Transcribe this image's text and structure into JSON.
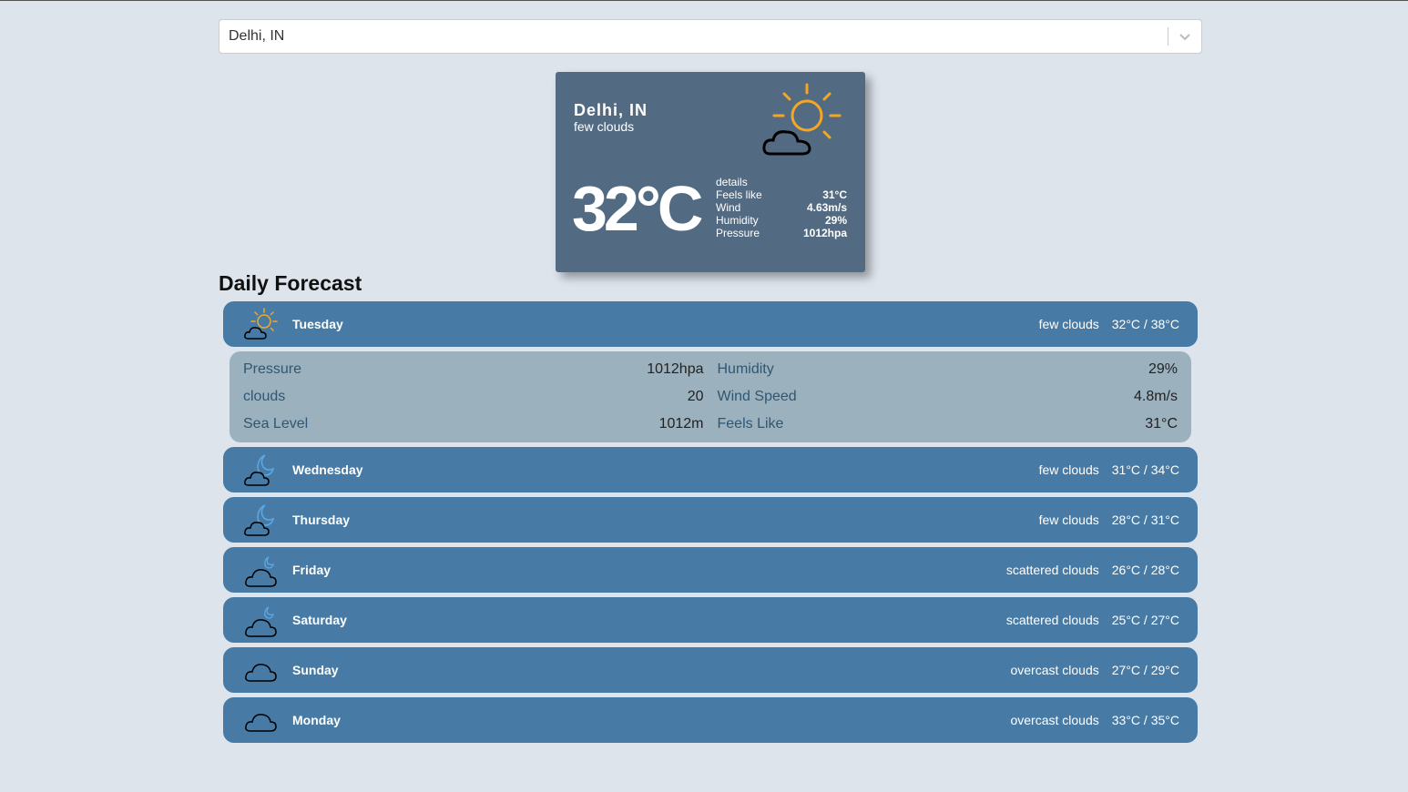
{
  "search": {
    "value": "Delhi, IN"
  },
  "current": {
    "city": "Delhi, IN",
    "description": "few clouds",
    "temp": "32°C",
    "details_heading": "details",
    "details": [
      {
        "label": "Feels like",
        "value": "31°C"
      },
      {
        "label": "Wind",
        "value": "4.63m/s"
      },
      {
        "label": "Humidity",
        "value": "29%"
      },
      {
        "label": "Pressure",
        "value": "1012hpa"
      }
    ],
    "icon": "partly-cloudy-day-icon"
  },
  "forecast": {
    "title": "Daily Forecast",
    "days": [
      {
        "name": "Tuesday",
        "desc": "few clouds",
        "temp": "32°C / 38°C",
        "icon": "partly-cloudy-day-icon",
        "expanded": true
      },
      {
        "name": "Wednesday",
        "desc": "few clouds",
        "temp": "31°C / 34°C",
        "icon": "partly-cloudy-night-icon"
      },
      {
        "name": "Thursday",
        "desc": "few clouds",
        "temp": "28°C / 31°C",
        "icon": "partly-cloudy-night-icon"
      },
      {
        "name": "Friday",
        "desc": "scattered clouds",
        "temp": "26°C / 28°C",
        "icon": "cloudy-night-icon"
      },
      {
        "name": "Saturday",
        "desc": "scattered clouds",
        "temp": "25°C / 27°C",
        "icon": "cloudy-night-icon"
      },
      {
        "name": "Sunday",
        "desc": "overcast clouds",
        "temp": "27°C / 29°C",
        "icon": "cloud-icon"
      },
      {
        "name": "Monday",
        "desc": "overcast clouds",
        "temp": "33°C / 35°C",
        "icon": "cloud-icon"
      }
    ],
    "expanded_details": {
      "left": [
        {
          "label": "Pressure",
          "value": "1012hpa"
        },
        {
          "label": "clouds",
          "value": "20"
        },
        {
          "label": "Sea Level",
          "value": "1012m"
        }
      ],
      "right": [
        {
          "label": "Humidity",
          "value": "29%"
        },
        {
          "label": "Wind Speed",
          "value": "4.8m/s"
        },
        {
          "label": "Feels Like",
          "value": "31°C"
        }
      ]
    }
  },
  "colors": {
    "background": "#dde4ec",
    "card": "#536b82",
    "day_bar": "#477ba5",
    "details_panel": "#9cb1be",
    "sun": "#f5a623"
  }
}
